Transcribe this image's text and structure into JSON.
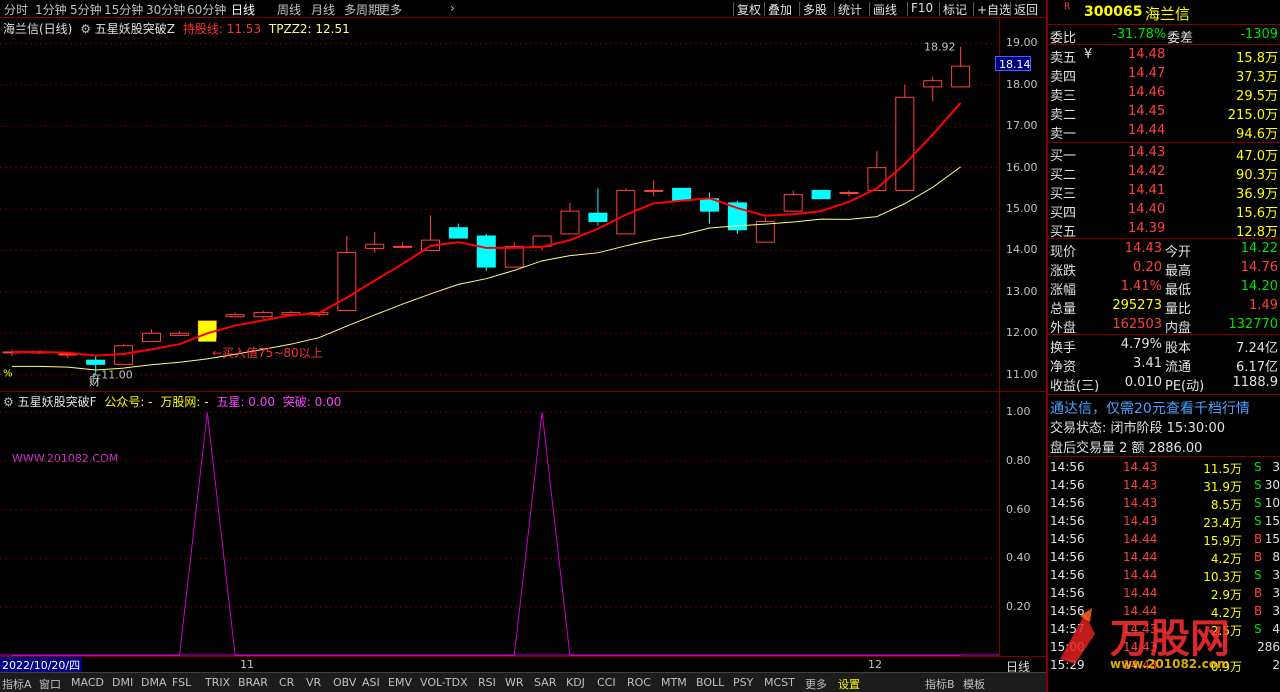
{
  "toolbar": {
    "left": [
      "分时",
      "1分钟",
      "5分钟",
      "15分钟",
      "30分钟",
      "60分钟",
      "日线",
      "周线",
      "月线",
      "多周期",
      "更多"
    ],
    "right": [
      "复权",
      "叠加",
      "多股",
      "统计",
      "画线",
      "F10",
      "标记",
      "+自选",
      "返回"
    ],
    "active": "日线"
  },
  "main_title": {
    "name": "海兰信(日线)",
    "indicator": "五星妖股突破Z",
    "line1_label": "持股线: 11.53",
    "line2_label": "TPZZ2: 12.51"
  },
  "price_axis": [
    "19.00",
    "18.00",
    "17.00",
    "16.00",
    "15.00",
    "14.00",
    "13.00",
    "12.00",
    "11.00"
  ],
  "price_tag": "18.14",
  "annotations": {
    "high": "18.92",
    "low": "11.00",
    "buy": "←买入值75~80以上",
    "cai": "财",
    "pct": "%"
  },
  "sub_title": {
    "name": "五星妖股突破F",
    "gzh": "公众号: -",
    "wgw": "万股网: -",
    "wx": "五星: 0.00",
    "tp": "突破: 0.00"
  },
  "watermark_url": "WWW.201082.COM",
  "sub_axis": [
    "1.00",
    "0.80",
    "0.60",
    "0.40",
    "0.20"
  ],
  "date_row": {
    "date": "2022/10/20/四",
    "m11": "11",
    "m12": "12",
    "period": "日线"
  },
  "tabs": [
    "指标A",
    "窗口",
    "MACD",
    "DMI",
    "DMA",
    "FSL",
    "TRIX",
    "BRAR",
    "CR",
    "VR",
    "OBV",
    "ASI",
    "EMV",
    "VOL-TDX",
    "RSI",
    "WR",
    "SAR",
    "KDJ",
    "CCI",
    "ROC",
    "MTM",
    "BOLL",
    "PSY",
    "MCST",
    "更多",
    "设置",
    "指标B",
    "模板"
  ],
  "tabs_active": "设置",
  "quote": {
    "code": "300065",
    "name": "海兰信",
    "badge": "R",
    "wb_label": "委比",
    "wb": "-31.78%",
    "wc_label": "委差",
    "wc": "-1309",
    "asks": [
      {
        "label": "卖五",
        "mark": "¥",
        "price": "14.48",
        "vol": "15.8万"
      },
      {
        "label": "卖四",
        "price": "14.47",
        "vol": "37.3万"
      },
      {
        "label": "卖三",
        "price": "14.46",
        "vol": "29.5万"
      },
      {
        "label": "卖二",
        "price": "14.45",
        "vol": "215.0万"
      },
      {
        "label": "卖一",
        "price": "14.44",
        "vol": "94.6万"
      }
    ],
    "bids": [
      {
        "label": "买一",
        "price": "14.43",
        "vol": "47.0万"
      },
      {
        "label": "买二",
        "price": "14.42",
        "vol": "90.3万"
      },
      {
        "label": "买三",
        "price": "14.41",
        "vol": "36.9万"
      },
      {
        "label": "买四",
        "price": "14.40",
        "vol": "15.6万"
      },
      {
        "label": "买五",
        "price": "14.39",
        "vol": "12.8万"
      }
    ],
    "stats": [
      {
        "l1": "现价",
        "v1": "14.43",
        "c1": "red",
        "l2": "今开",
        "v2": "14.22",
        "c2": "green"
      },
      {
        "l1": "涨跌",
        "v1": "0.20",
        "c1": "red",
        "l2": "最高",
        "v2": "14.76",
        "c2": "red"
      },
      {
        "l1": "涨幅",
        "v1": "1.41%",
        "c1": "red",
        "l2": "最低",
        "v2": "14.20",
        "c2": "green"
      },
      {
        "l1": "总量",
        "v1": "295273",
        "c1": "yellow",
        "l2": "量比",
        "v2": "1.49",
        "c2": "red"
      },
      {
        "l1": "外盘",
        "v1": "162503",
        "c1": "red",
        "l2": "内盘",
        "v2": "132770",
        "c2": "green"
      }
    ],
    "stats2": [
      {
        "l1": "换手",
        "v1": "4.79%",
        "l2": "股本",
        "v2": "7.24亿"
      },
      {
        "l1": "净资",
        "v1": "3.41",
        "l2": "流通",
        "v2": "6.17亿"
      },
      {
        "l1": "收益(三)",
        "v1": "0.010",
        "l2": "PE(动)",
        "v2": "1188.9"
      }
    ],
    "promo": "通达信，仅需20元查看千档行情",
    "status": "交易状态: 闭市阶段 15:30:00",
    "after": "盘后交易量 2 额 2886.00",
    "ticks": [
      {
        "t": "14:56",
        "p": "14.43",
        "v": "11.5万",
        "s": "S",
        "n": "3"
      },
      {
        "t": "14:56",
        "p": "14.43",
        "v": "31.9万",
        "s": "S",
        "n": "30"
      },
      {
        "t": "14:56",
        "p": "14.43",
        "v": "8.5万",
        "s": "S",
        "n": "10"
      },
      {
        "t": "14:56",
        "p": "14.43",
        "v": "23.4万",
        "s": "S",
        "n": "15"
      },
      {
        "t": "14:56",
        "p": "14.44",
        "v": "15.9万",
        "s": "B",
        "n": "15"
      },
      {
        "t": "14:56",
        "p": "14.44",
        "v": "4.2万",
        "s": "B",
        "n": "8"
      },
      {
        "t": "14:56",
        "p": "14.44",
        "v": "10.3万",
        "s": "S",
        "n": "3"
      },
      {
        "t": "14:56",
        "p": "14.44",
        "v": "2.9万",
        "s": "B",
        "n": "3"
      },
      {
        "t": "14:56",
        "p": "14.44",
        "v": "4.2万",
        "s": "B",
        "n": "3"
      },
      {
        "t": "14:57",
        "p": "14.43",
        "v": "2.5万",
        "s": "S",
        "n": "4"
      },
      {
        "t": "15:00",
        "p": "14.43",
        "v": "",
        "s": "",
        "n": "286"
      },
      {
        "t": "15:29",
        "p": "14.43",
        "v": "0.9万",
        "s": "",
        "n": "2"
      }
    ],
    "colors": {
      "up": "#ff4040",
      "down": "#00ffff",
      "ma1": "#ff0000",
      "ma2": "#ffff80",
      "wx": "#cc00cc",
      "buy": "#ffff00"
    }
  },
  "chart_data": {
    "type": "candlestick",
    "series": [
      {
        "ohlc": [
          [
            11.55,
            11.6,
            11.45,
            11.55
          ],
          [
            11.55,
            11.6,
            11.5,
            11.55
          ],
          [
            11.5,
            11.55,
            11.4,
            11.5
          ],
          [
            11.35,
            11.45,
            11.0,
            11.25
          ],
          [
            11.25,
            11.75,
            11.25,
            11.7
          ],
          [
            11.8,
            12.1,
            11.8,
            12.0
          ],
          [
            11.95,
            12.05,
            11.95,
            12.0
          ],
          [
            11.9,
            12.3,
            11.9,
            12.3
          ],
          [
            12.4,
            12.5,
            12.4,
            12.45
          ],
          [
            12.4,
            12.55,
            12.35,
            12.5
          ],
          [
            12.45,
            12.55,
            12.4,
            12.5
          ],
          [
            12.45,
            12.5,
            12.4,
            12.5
          ],
          [
            12.55,
            14.35,
            12.55,
            13.95
          ],
          [
            14.05,
            14.45,
            13.95,
            14.15
          ],
          [
            14.1,
            14.2,
            14.05,
            14.1
          ],
          [
            14.0,
            14.85,
            14.0,
            14.25
          ],
          [
            14.55,
            14.65,
            14.3,
            14.3
          ],
          [
            14.35,
            14.4,
            13.5,
            13.6
          ],
          [
            13.6,
            14.2,
            13.6,
            14.1
          ],
          [
            14.1,
            14.35,
            14.0,
            14.35
          ],
          [
            14.4,
            15.15,
            14.4,
            14.95
          ],
          [
            14.9,
            15.5,
            14.6,
            14.7
          ],
          [
            14.4,
            15.5,
            14.4,
            15.45
          ],
          [
            15.45,
            15.7,
            15.3,
            15.45
          ],
          [
            15.5,
            15.4,
            15.2,
            15.2
          ],
          [
            15.25,
            15.4,
            14.65,
            14.95
          ],
          [
            15.15,
            15.2,
            14.4,
            14.5
          ],
          [
            14.2,
            14.8,
            14.2,
            14.7
          ],
          [
            14.95,
            15.45,
            14.95,
            15.35
          ],
          [
            15.45,
            15.45,
            15.35,
            15.25
          ],
          [
            15.4,
            15.45,
            15.3,
            15.4
          ],
          [
            15.45,
            16.4,
            15.45,
            16.0
          ],
          [
            15.45,
            18.0,
            15.45,
            17.7
          ],
          [
            17.95,
            18.2,
            17.6,
            18.1
          ],
          [
            17.95,
            18.92,
            17.95,
            18.45
          ]
        ]
      },
      {
        "name": "持股线",
        "last": 11.53
      },
      {
        "name": "TPZZ2",
        "last": 12.51
      }
    ],
    "ylim": [
      10.8,
      19.3
    ],
    "sub_values": [
      0,
      0,
      0,
      0,
      0,
      0,
      0,
      1,
      0,
      0,
      0,
      0,
      0,
      0,
      0,
      0,
      0,
      0,
      0,
      1,
      0,
      0,
      0,
      0,
      0,
      0,
      0,
      0,
      0,
      0,
      0,
      0,
      0,
      0,
      0
    ],
    "sub_ylim": [
      0,
      1.05
    ]
  }
}
